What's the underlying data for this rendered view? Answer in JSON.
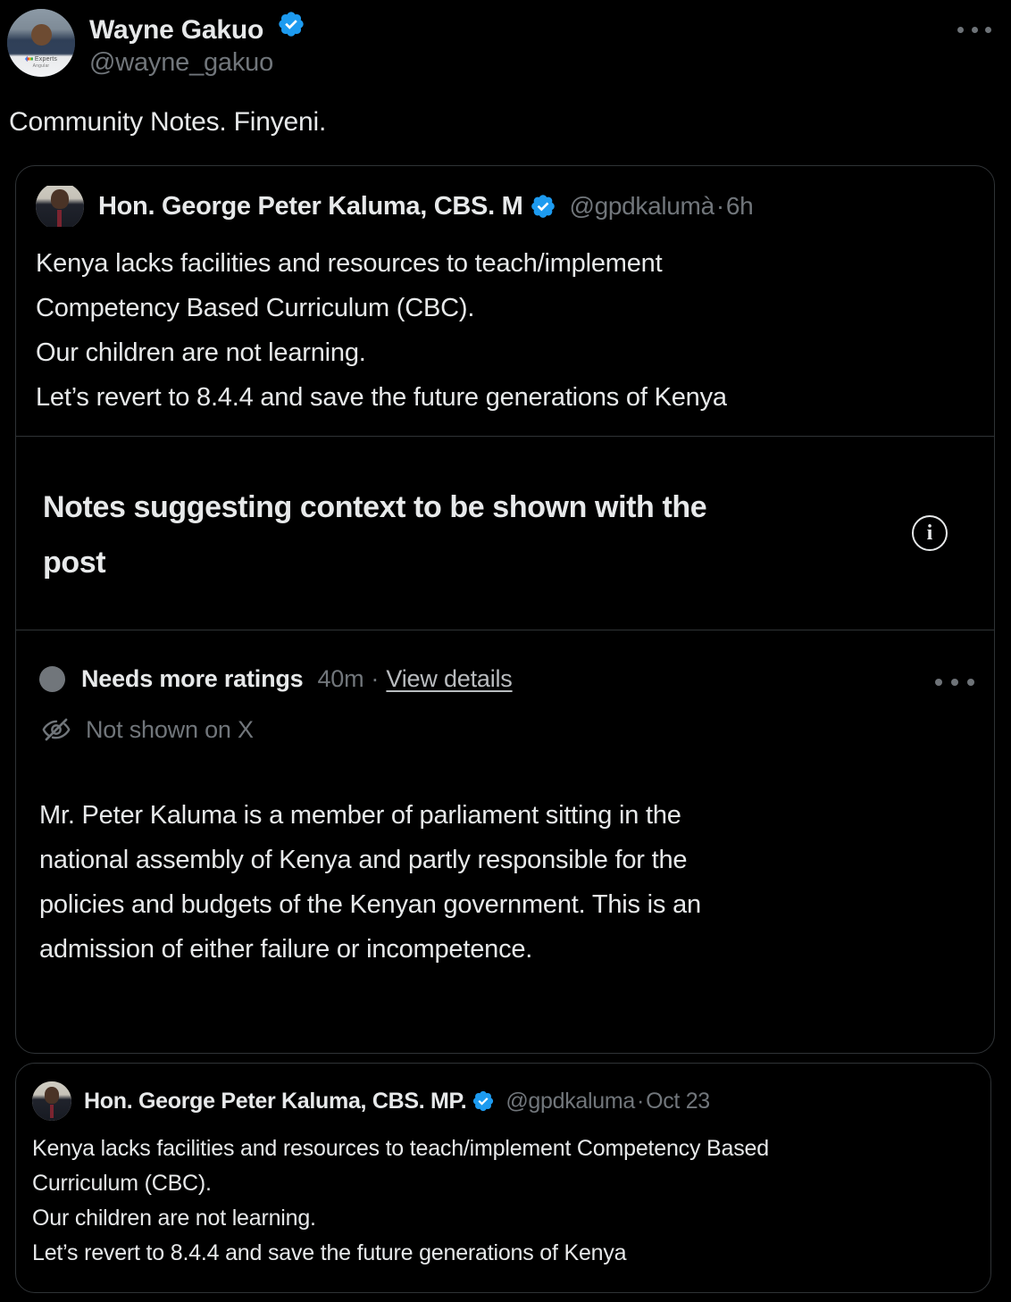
{
  "colors": {
    "background": "#000000",
    "text_primary": "#e7e9ea",
    "text_secondary": "#71767b",
    "border": "#2f3336",
    "verified_blue": "#1d9bf0",
    "status_dot_gray": "#71767b"
  },
  "author": {
    "display_name": "Wayne Gakuo",
    "handle": "@wayne_gakuo",
    "verified_icon": "verified-badge-icon",
    "avatar_icon": "avatar-wayne-gakuo",
    "avatar_overlay_label": "Experts",
    "avatar_overlay_sub": "Angular",
    "more_menu_icon": "more-horizontal-icon"
  },
  "post": {
    "text": "Community Notes. Finyeni."
  },
  "quoted_post": {
    "display_name": "Hon. George Peter Kaluma, CBS. M",
    "verified_icon": "verified-badge-icon",
    "handle": "@gpdkalumà",
    "separator": "·",
    "timestamp": "6h",
    "avatar_icon": "avatar-george-kaluma",
    "body_lines": [
      "Kenya lacks facilities and resources to teach/implement",
      "Competency Based Curriculum  (CBC).",
      "Our children are not learning.",
      "Let’s revert to 8.4.4 and save the future generations of Kenya"
    ]
  },
  "notes_header": {
    "title": "Notes suggesting context to be shown with the post",
    "info_icon": "info-circle-icon",
    "info_glyph": "i"
  },
  "note": {
    "status_dot_icon": "status-dot-icon",
    "status_label": "Needs more ratings",
    "timestamp": "40m",
    "separator": "·",
    "view_details_label": "View details",
    "more_menu_icon": "more-horizontal-icon",
    "visibility_icon": "eye-slash-icon",
    "visibility_label": "Not shown on X",
    "body_lines": [
      "Mr. Peter Kaluma is a member of parliament sitting in the",
      "national assembly of Kenya and partly responsible for the",
      "policies and budgets of the Kenyan government. This is an",
      "admission of either failure or incompetence."
    ]
  },
  "embedded_post": {
    "display_name": "Hon. George Peter Kaluma, CBS. MP.",
    "verified_icon": "verified-badge-icon",
    "handle": "@gpdkaluma",
    "separator": "·",
    "timestamp": "Oct 23",
    "avatar_icon": "avatar-george-kaluma",
    "body_lines": [
      "Kenya lacks facilities and resources to teach/implement Competency Based",
      "Curriculum  (CBC).",
      "Our children are not learning.",
      "Let’s revert to 8.4.4 and save the future generations of Kenya"
    ]
  }
}
